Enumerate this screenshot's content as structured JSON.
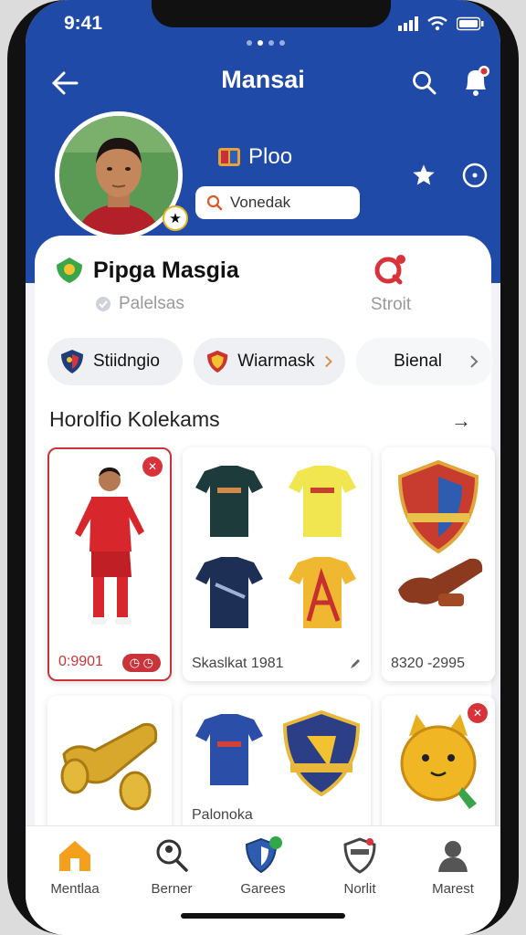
{
  "status": {
    "time": "9:41"
  },
  "header": {
    "title": "Mansai"
  },
  "profile": {
    "name": "Ploo",
    "search_value": "Vonedak"
  },
  "club": {
    "name": "Pipga Masgia",
    "subtitle": "Palelsas",
    "action_label": "Stroit"
  },
  "chips": [
    {
      "label": "Stiidngio"
    },
    {
      "label": "Wiarmask"
    },
    {
      "label": "Bienal"
    }
  ],
  "collection": {
    "title": "Horolfio Kolekams",
    "see_all": "→",
    "items": [
      {
        "price": "0:9901",
        "tag": ""
      },
      {
        "price": "Skaslkat 1981"
      },
      {
        "price": "8320 -2995"
      }
    ],
    "bottom_label": "Palonoka"
  },
  "tabs": [
    {
      "label": "Mentlaa"
    },
    {
      "label": "Berner"
    },
    {
      "label": "Garees"
    },
    {
      "label": "Norlit"
    },
    {
      "label": "Marest"
    }
  ],
  "colors": {
    "header": "#1f4aa8",
    "accent": "#c9343a",
    "tab_active": "#f4a01c"
  }
}
